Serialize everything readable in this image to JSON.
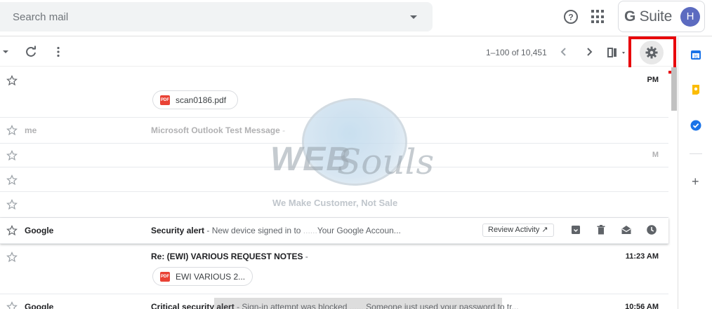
{
  "header": {
    "search_placeholder": "Search mail",
    "brand_prefix": "G",
    "brand_rest": " Suite",
    "avatar_initial": "H"
  },
  "toolbar": {
    "pagination": "1–100 of 10,451",
    "icons": [
      "select-caret",
      "refresh-icon",
      "more-vert-icon",
      "prev-page-icon",
      "next-page-icon",
      "split-pane-icon",
      "settings-gear-icon"
    ]
  },
  "rows": [
    {
      "sender": "",
      "subject": "",
      "snippet": "",
      "time": "PM",
      "attachment": "scan0186.pdf"
    },
    {
      "sender": "me",
      "subject": "Microsoft Outlook Test Message",
      "snippet": " - ",
      "time": "",
      "attachment": ""
    },
    {
      "sender": "",
      "subject": "",
      "snippet": "",
      "time": "M",
      "attachment": ""
    },
    {
      "sender": "",
      "subject": "",
      "snippet": "",
      "time": "",
      "attachment": ""
    },
    {
      "sender": "",
      "subject": "",
      "snippet": "",
      "time": "",
      "attachment": ""
    },
    {
      "sender": "Google",
      "subject": "Security alert",
      "snippet": " - New device signed in to ",
      "snippet_tail": "Your Google Accoun...",
      "time": "",
      "action": "Review Activity ↗",
      "attachment": ""
    },
    {
      "sender": "",
      "subject": "Re: (EWI) VARIOUS REQUEST NOTES",
      "snippet": " - ",
      "time": "11:23 AM",
      "attachment": "EWI VARIOUS 2..."
    },
    {
      "sender": "Google",
      "subject": "Critical security alert",
      "snippet": " - Sign-in attempt was blocked",
      "snippet_tail": "Someone just used your password to tr...",
      "time": "10:56 AM",
      "attachment": ""
    }
  ],
  "watermark": {
    "word1": "WEB",
    "word2": "Souls",
    "tagline": "We Make Customer, Not Sale"
  },
  "colors": {
    "highlight": "#e8000b",
    "pdf": "#e94235",
    "avatar": "#5c6bc0"
  }
}
